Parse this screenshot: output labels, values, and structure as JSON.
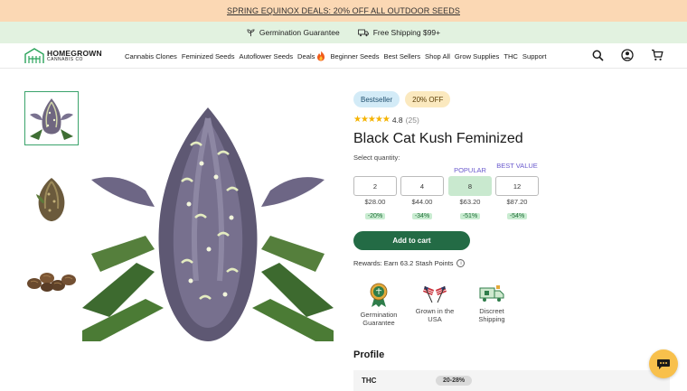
{
  "promo": {
    "text": "SPRING EQUINOX DEALS: 20% OFF ALL OUTDOOR SEEDS"
  },
  "features": [
    {
      "icon": "sprout-icon",
      "label": "Germination Guarantee"
    },
    {
      "icon": "truck-icon",
      "label": "Free Shipping $99+"
    }
  ],
  "logo": {
    "line1": "HOMEGROWN",
    "line2": "CANNABIS CO"
  },
  "menu": [
    "Cannabis Clones",
    "Feminized Seeds",
    "Autoflower Seeds",
    "Deals",
    "Beginner Seeds",
    "Best Sellers",
    "Shop All",
    "Grow Supplies",
    "THC",
    "Support"
  ],
  "product": {
    "badges": {
      "bestseller": "Bestseller",
      "discount": "20% OFF"
    },
    "rating": {
      "stars": "★★★★★",
      "value": "4.8",
      "count": "(25)"
    },
    "title": "Black Cat Kush Feminized",
    "select_label": "Select quantity:",
    "quantities": [
      {
        "qty": "2",
        "price": "$28.00",
        "discount": "-20%",
        "tag": ""
      },
      {
        "qty": "4",
        "price": "$44.00",
        "discount": "-34%",
        "tag": ""
      },
      {
        "qty": "8",
        "price": "$63.20",
        "discount": "-51%",
        "tag": "POPULAR"
      },
      {
        "qty": "12",
        "price": "$87.20",
        "discount": "-54%",
        "tag": "BEST VALUE"
      }
    ],
    "selected_quantity": "8",
    "add_to_cart": "Add to cart",
    "rewards": "Rewards: Earn 63.2 Stash Points",
    "trust": [
      {
        "icon": "award-ribbon-icon",
        "label": "Germination Guarantee"
      },
      {
        "icon": "flags-icon",
        "label": "Grown in the USA"
      },
      {
        "icon": "delivery-truck-icon",
        "label": "Discreet Shipping"
      }
    ],
    "profile_heading": "Profile",
    "profile": [
      {
        "key": "THC",
        "value": "20-28%"
      }
    ]
  },
  "colors": {
    "promo_bg": "#fbd8b4",
    "features_bg": "#e2f2e0",
    "brand_green": "#236b45",
    "chat_bg": "#f8c04c"
  }
}
